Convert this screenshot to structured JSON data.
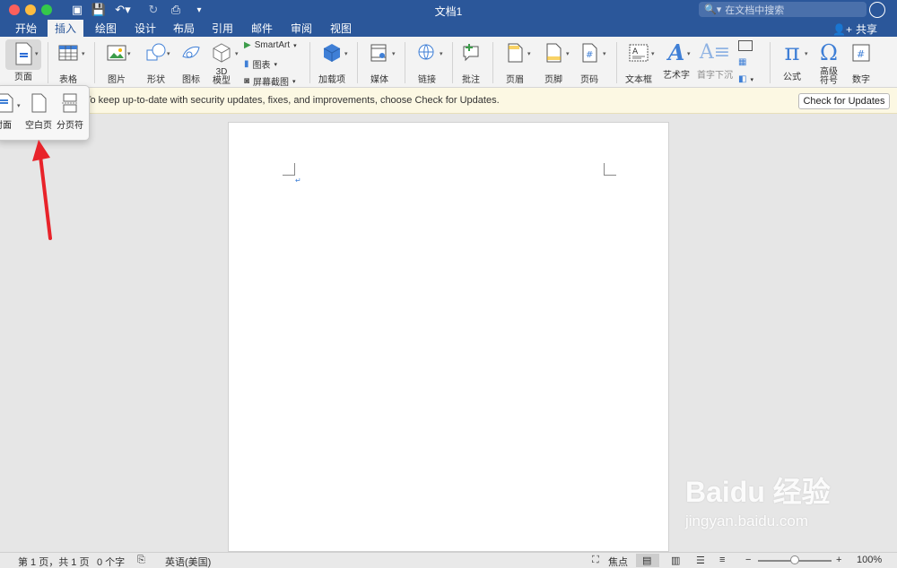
{
  "window": {
    "title": "文档1"
  },
  "search": {
    "placeholder": "在文档中搜索"
  },
  "tabs": [
    {
      "label": "开始"
    },
    {
      "label": "插入"
    },
    {
      "label": "绘图"
    },
    {
      "label": "设计"
    },
    {
      "label": "布局"
    },
    {
      "label": "引用"
    },
    {
      "label": "邮件"
    },
    {
      "label": "审阅"
    },
    {
      "label": "视图"
    }
  ],
  "active_tab": "插入",
  "share_label": "共享",
  "ribbon": {
    "page": "页面",
    "table": "表格",
    "picture": "图片",
    "shapes": "形状",
    "icons": "图标",
    "model3d": "3D\n模型",
    "smartart": "SmartArt",
    "chart": "图表",
    "screenshot": "屏幕截图",
    "addins": "加载项",
    "media": "媒体",
    "link": "链接",
    "comment": "批注",
    "header": "页眉",
    "footer": "页脚",
    "page_number": "页码",
    "textbox": "文本框",
    "wordart": "艺术字",
    "dropcap": "首字下沉",
    "equation": "公式",
    "advanced_symbol": "高级\n符号",
    "number": "数字"
  },
  "popup": {
    "cover": "封面",
    "blank_page": "空白页",
    "page_break": "分页符"
  },
  "update_bar": {
    "message": "To keep up-to-date with security updates, fixes, and improvements, choose Check for Updates.",
    "button": "Check for Updates"
  },
  "status": {
    "page": "第 1 页，共 1 页",
    "words": "0 个字",
    "language": "英语(美国)",
    "focus": "焦点",
    "zoom": "100%",
    "zoom_level": 0.5
  },
  "watermark": {
    "brand": "Baidu 经验",
    "url": "jingyan.baidu.com"
  },
  "colors": {
    "accent": "#2b579a",
    "arrow": "#e8232a"
  }
}
